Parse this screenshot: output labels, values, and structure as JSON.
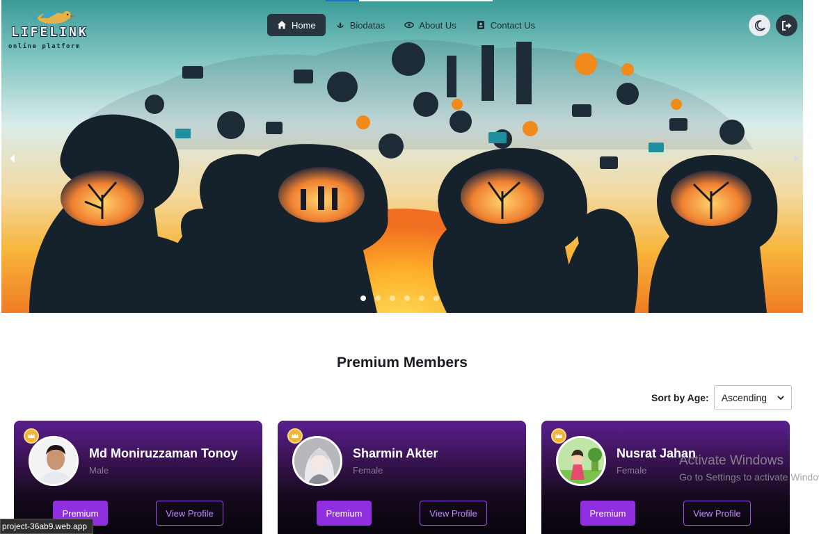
{
  "brand": {
    "name": "LIFELINK",
    "tagline": "online platform"
  },
  "nav": {
    "items": [
      {
        "label": "Home",
        "icon": "home-icon",
        "active": true
      },
      {
        "label": "Biodatas",
        "icon": "biodata-icon",
        "active": false
      },
      {
        "label": "About Us",
        "icon": "about-icon",
        "active": false
      },
      {
        "label": "Contact Us",
        "icon": "contact-icon",
        "active": false
      }
    ]
  },
  "header_actions": {
    "theme_icon": "moon-icon",
    "logout_icon": "logout-icon"
  },
  "carousel": {
    "slides": 6,
    "active_slide": 1,
    "prev_icon": "chevron-left-icon",
    "next_icon": "chevron-right-icon"
  },
  "premium": {
    "title": "Premium Members",
    "sort_label": "Sort by Age:",
    "sort_value": "Ascending",
    "members": [
      {
        "name": "Md Moniruzzaman Tonoy",
        "gender": "Male",
        "badge": "Premium",
        "action": "View Profile"
      },
      {
        "name": "Sharmin Akter",
        "gender": "Female",
        "badge": "Premium",
        "action": "View Profile"
      },
      {
        "name": "Nusrat Jahan",
        "gender": "Female",
        "badge": "Premium",
        "action": "View Profile"
      }
    ]
  },
  "watermark": {
    "line1": "Activate Windows",
    "line2": "Go to Settings to activate Windows."
  },
  "status_bar": {
    "url": "project-36ab9.web.app"
  },
  "colors": {
    "nav_active": "#28343f",
    "premium_button": "#8f2fe0",
    "card_top": "#5a1f8f",
    "crown": "#f0b43a"
  }
}
